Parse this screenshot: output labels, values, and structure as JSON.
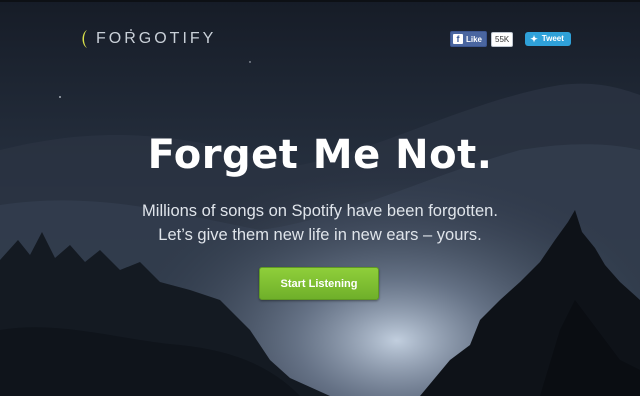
{
  "brand": {
    "name": "FORGOTIFY",
    "icon": "crescent-moon-icon"
  },
  "social": {
    "facebook_like_label": "Like",
    "facebook_count": "55K",
    "tweet_label": "Tweet"
  },
  "hero": {
    "title": "Forget Me Not.",
    "subtitle_line1": "Millions of songs on Spotify have been forgotten.",
    "subtitle_line2": "Let’s give them new life in new ears – yours.",
    "cta_label": "Start Listening"
  },
  "colors": {
    "accent_green": "#7cc034",
    "facebook_blue": "#4a66a0",
    "twitter_blue": "#2fa1d9",
    "moon_yellow": "#d8e04a"
  }
}
